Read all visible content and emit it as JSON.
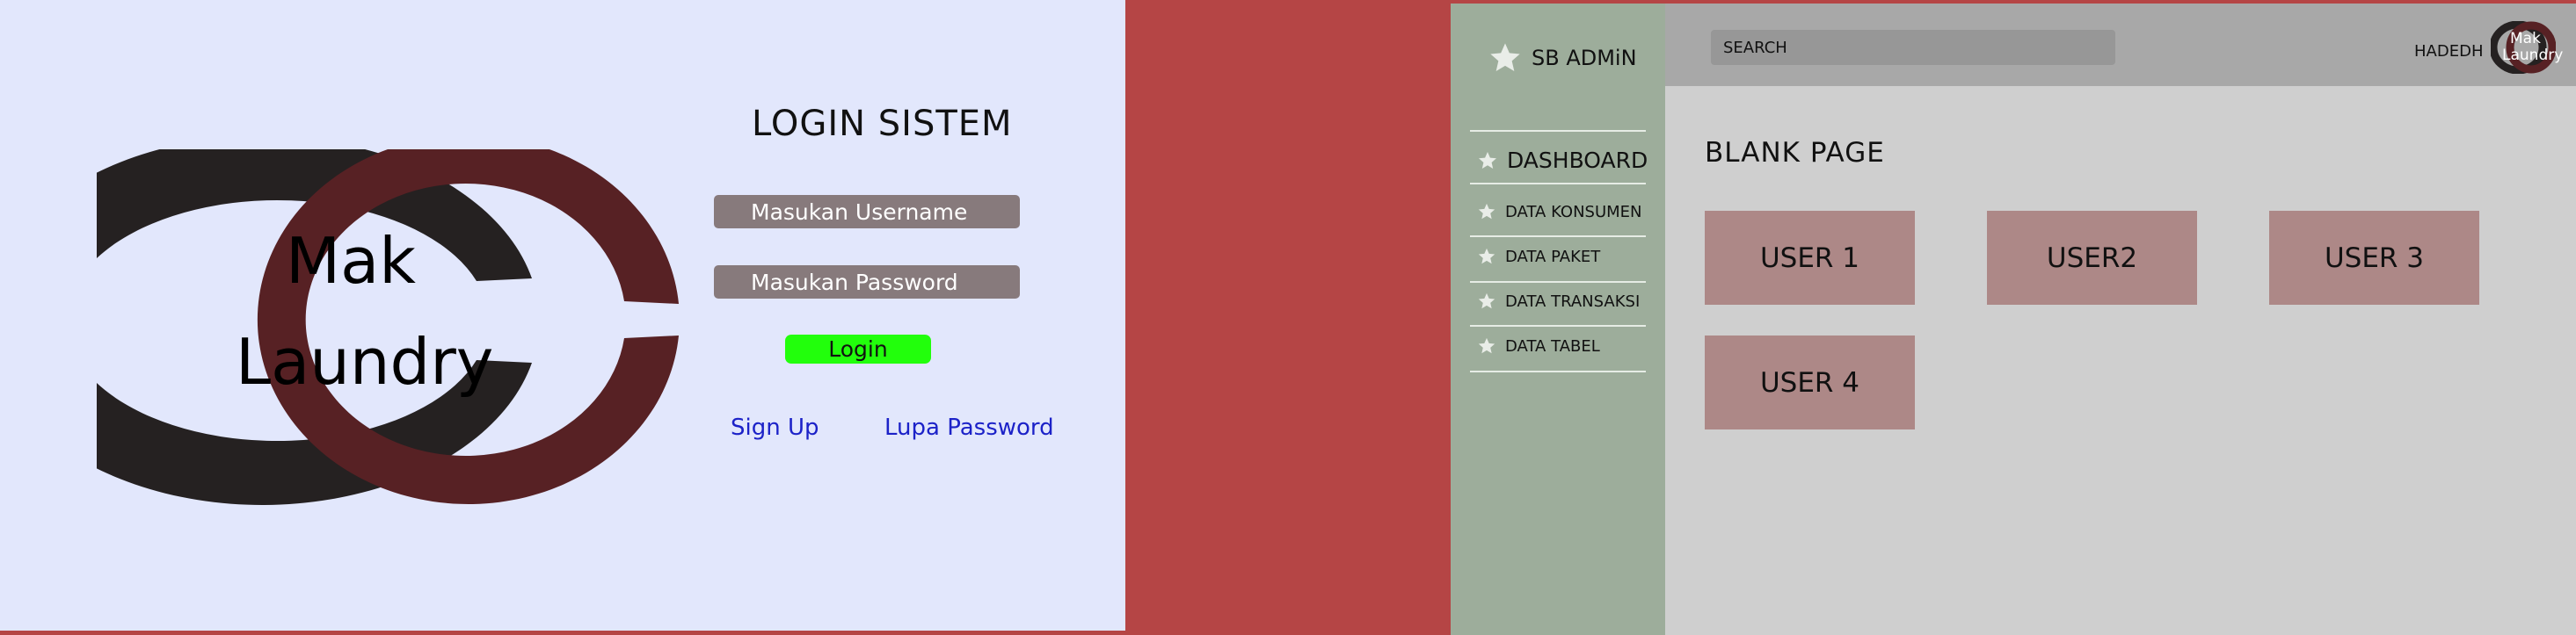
{
  "login": {
    "logo_line1": "Mak",
    "logo_line2": "Laundry",
    "title": "LOGIN SISTEM",
    "username_placeholder": "Masukan Username",
    "password_placeholder": "Masukan Password",
    "login_button": "Login",
    "signup_link": "Sign Up",
    "forgot_link": "Lupa Password"
  },
  "admin": {
    "brand": "SB ADMiN",
    "sidebar": {
      "items": [
        {
          "label": "DASHBOARD",
          "icon": "star-icon"
        },
        {
          "label": "DATA KONSUMEN",
          "icon": "star-icon"
        },
        {
          "label": "DATA PAKET",
          "icon": "star-icon"
        },
        {
          "label": "DATA TRANSAKSI",
          "icon": "star-icon"
        },
        {
          "label": "DATA TABEL",
          "icon": "star-icon"
        }
      ]
    },
    "topbar": {
      "search_placeholder": "SEARCH",
      "user_name": "HADEDH",
      "avatar_line1": "Mak",
      "avatar_line2": "Laundry"
    },
    "main": {
      "title": "BLANK PAGE",
      "cards": [
        "USER 1",
        "USER2",
        "USER 3",
        "USER 4"
      ]
    }
  },
  "colors": {
    "background": "#b54545",
    "login_bg": "#e2e7fc",
    "logo_dark": "#252121",
    "logo_red": "#572124",
    "input_bg": "#877a7c",
    "login_button": "#22ff0c",
    "link": "#1c22c8",
    "sidebar_bg": "#9dad9b",
    "topbar_bg": "#a8a8a8",
    "content_bg": "#cfcfcf",
    "card_bg": "#ad8887"
  }
}
